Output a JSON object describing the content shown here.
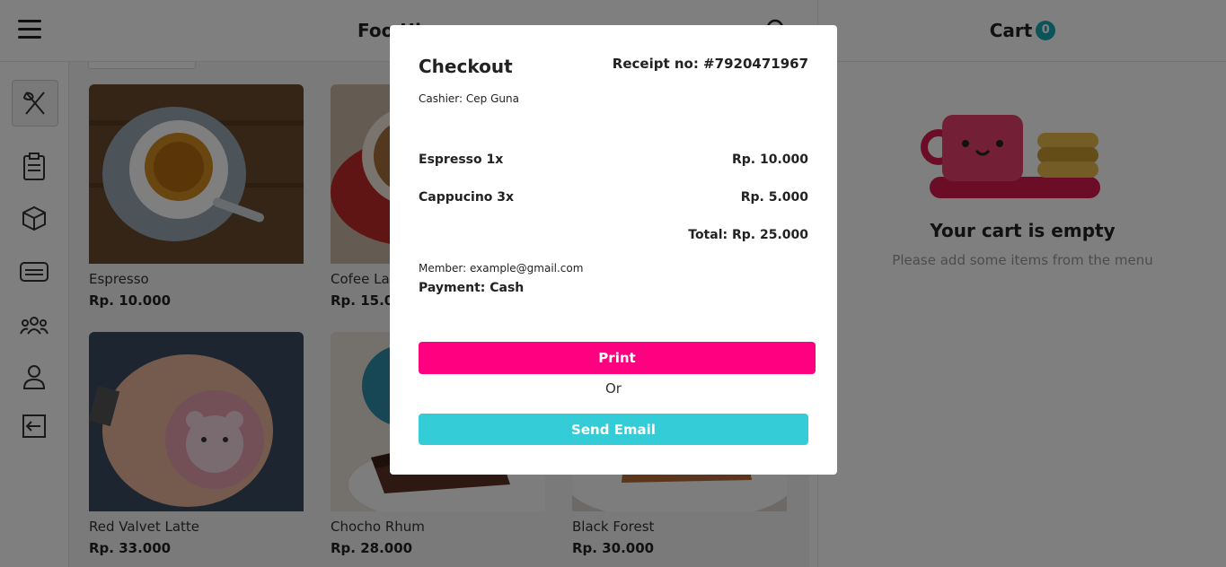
{
  "header": {
    "title": "Foo Hi"
  },
  "sidebar": {
    "items": [
      {
        "icon": "utensils-icon"
      },
      {
        "icon": "clipboard-icon"
      },
      {
        "icon": "box-icon"
      },
      {
        "icon": "card-icon"
      },
      {
        "icon": "users-icon"
      },
      {
        "icon": "user-icon"
      },
      {
        "icon": "logout-icon"
      }
    ]
  },
  "menu": {
    "items": [
      {
        "name": "Espresso",
        "price": "Rp. 10.000"
      },
      {
        "name": "Cofee La",
        "price": "Rp. 15.00"
      },
      {
        "name": "Red Valvet Latte",
        "price": "Rp. 33.000"
      },
      {
        "name": "Chocho Rhum",
        "price": "Rp. 28.000"
      },
      {
        "name": "Black Forest",
        "price": "Rp. 30.000"
      }
    ]
  },
  "cart": {
    "title": "Cart",
    "count": "0",
    "empty_title": "Your cart is empty",
    "empty_subtitle": "Please add some items from the menu"
  },
  "checkout": {
    "title": "Checkout",
    "receipt": "Receipt no: #7920471967",
    "cashier": "Cashier: Cep Guna",
    "lines": [
      {
        "item": "Espresso 1x",
        "amount": "Rp. 10.000"
      },
      {
        "item": "Cappucino 3x",
        "amount": "Rp. 5.000"
      }
    ],
    "total": "Total: Rp. 25.000",
    "member": "Member: example@gmail.com",
    "payment": "Payment: Cash",
    "print_label": "Print",
    "or_label": "Or",
    "email_label": "Send Email"
  },
  "colors": {
    "print": "#ff0080",
    "email": "#34ccd6",
    "badge": "#1aa9b5"
  }
}
